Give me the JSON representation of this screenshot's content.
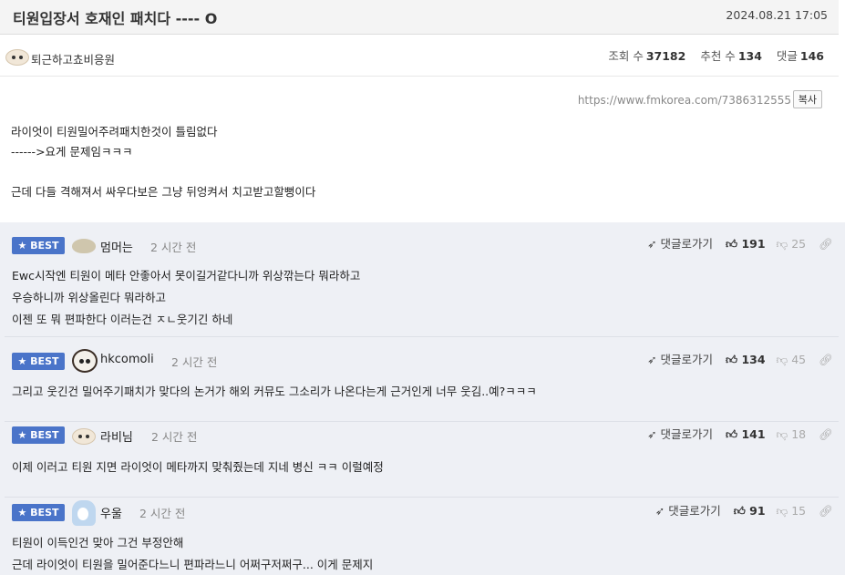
{
  "post": {
    "title": "티원입장서 호재인 패치다 ---- O",
    "date": "2024.08.21 17:05",
    "author": "퇴근하고쵸비응원",
    "stats": {
      "views_label": "조회 수",
      "views": "37182",
      "recommends_label": "추천 수",
      "recommends": "134",
      "comments_label": "댓글",
      "comments": "146"
    },
    "source_url": "https://www.fmkorea.com/7386312555",
    "copy_label": "복사",
    "body_lines": [
      "라이엇이 티원밀어주려패치한것이 틀림없다",
      "------>요게 문제임ㅋㅋㅋ",
      "근데 다들 격해져서 싸우다보은 그냥 뒤엉켜서 치고받고할뻥이다"
    ]
  },
  "comment_ui": {
    "best_label": "★ BEST",
    "reply_label": "댓글로가기",
    "up_icon": "thumb-up-icon",
    "down_icon": "thumb-down-icon",
    "link_icon": "link-icon"
  },
  "comments": [
    {
      "name": "멈머는",
      "time": "2 시간 전",
      "up": "191",
      "down": "25",
      "lines": [
        "Ewc시작엔 티원이 메타 안좋아서 못이길거같다니까 위상깎는다 뭐라하고",
        "우승하니까 위상올린다 뭐라하고",
        "이젠 또 뭐 편파한다 이러는건 ㅈㄴ웃기긴 하네"
      ]
    },
    {
      "name": "hkcomoli",
      "time": "2 시간 전",
      "up": "134",
      "down": "45",
      "lines": [
        "그리고 웃긴건 밀어주기패치가 맞다의 논거가 해외 커뮤도 그소리가 나온다는게 근거인게 너무 웃김..예?ㅋㅋㅋ"
      ]
    },
    {
      "name": "라비님",
      "time": "2 시간 전",
      "up": "141",
      "down": "18",
      "lines": [
        "이제 이러고 티원 지면 라이엇이 메타까지 맞춰줬는데 지네 병신 ㅋㅋ 이럴예정"
      ]
    },
    {
      "name": "우울",
      "time": "2 시간 전",
      "up": "91",
      "down": "15",
      "lines": [
        "티원이 이득인건 맞아 그건 부정안해",
        "근데 라이엇이 티원을 밀어준다느니 편파라느니 어쩌구저쩌구... 이게 문제지"
      ]
    }
  ]
}
